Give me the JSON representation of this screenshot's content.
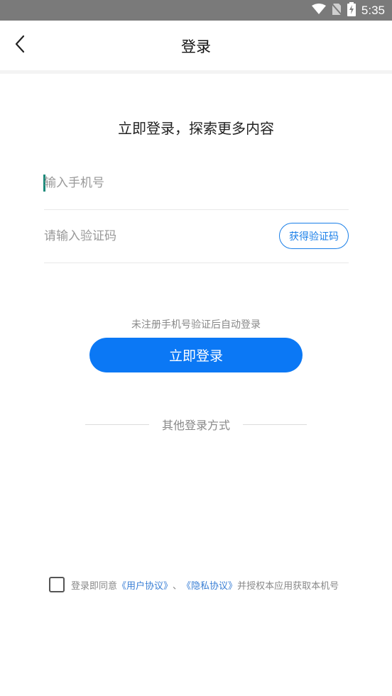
{
  "status_bar": {
    "time": "5:35",
    "icons": [
      "wifi-icon",
      "no-sim-icon",
      "battery-charging-icon"
    ]
  },
  "nav": {
    "title": "登录",
    "back_icon": "chevron-left-icon"
  },
  "headline": "立即登录，探索更多内容",
  "phone_field": {
    "placeholder": "输入手机号",
    "value": ""
  },
  "code_field": {
    "placeholder": "请输入验证码",
    "value": "",
    "get_code_label": "获得验证码"
  },
  "hint": "未注册手机号验证后自动登录",
  "login_button": "立即登录",
  "other_login_label": "其他登录方式",
  "agreement": {
    "checked": false,
    "prefix": "登录即同意",
    "user_agreement": "《用户协议》",
    "separator": "、",
    "privacy_agreement": "《隐私协议》",
    "suffix": "并授权本应用获取本机号"
  },
  "colors": {
    "accent": "#0b78f5",
    "link": "#3a7fd5",
    "status_bar": "#7a7a7a"
  }
}
